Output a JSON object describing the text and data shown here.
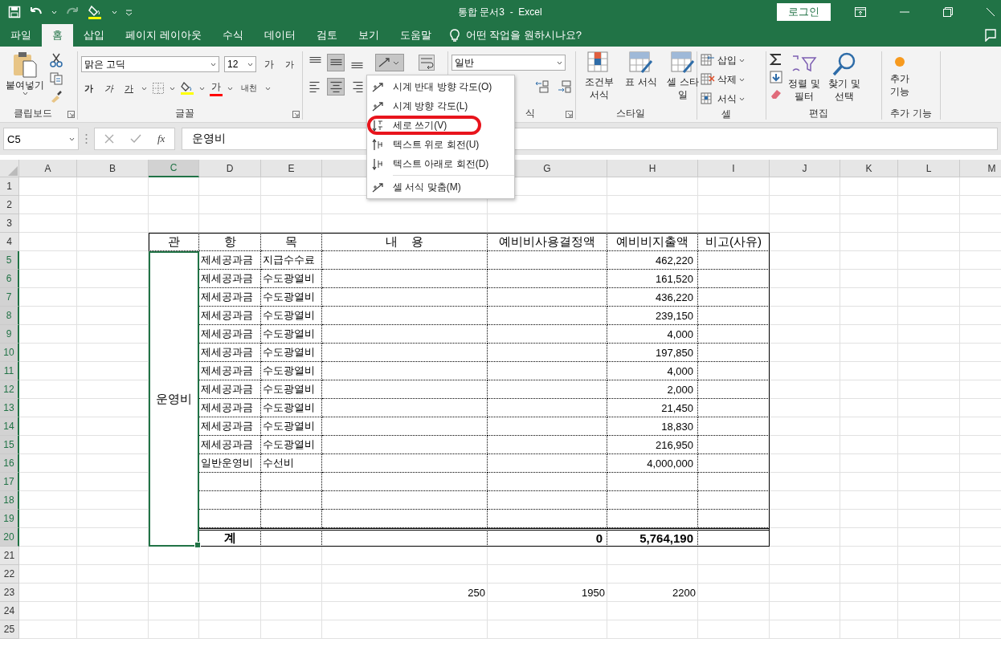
{
  "window": {
    "title": "통합 문서3  -  Excel",
    "login": "로그인"
  },
  "tabs": [
    {
      "label": "파일",
      "selected": false
    },
    {
      "label": "홈",
      "selected": true
    },
    {
      "label": "삽입",
      "selected": false
    },
    {
      "label": "페이지 레이아웃",
      "selected": false
    },
    {
      "label": "수식",
      "selected": false
    },
    {
      "label": "데이터",
      "selected": false
    },
    {
      "label": "검토",
      "selected": false
    },
    {
      "label": "보기",
      "selected": false
    },
    {
      "label": "도움말",
      "selected": false
    }
  ],
  "tell_me": "어떤 작업을 원하시나요?",
  "ribbon": {
    "clipboard": {
      "paste": "붙여넣기",
      "label": "클립보드"
    },
    "font": {
      "name": "맑은 고딕",
      "size": "12",
      "grow": "가",
      "shrink": "가",
      "bold": "가",
      "italic": "가",
      "underline": "가",
      "font_color": "가",
      "phonetic": "내천",
      "label": "글꼴"
    },
    "alignment": {
      "buttons": [
        {
          "kind": "top",
          "selected": false
        },
        {
          "kind": "middle",
          "selected": true
        },
        {
          "kind": "bottom",
          "selected": false
        },
        {
          "kind": "left",
          "selected": false
        },
        {
          "kind": "center",
          "selected": true
        },
        {
          "kind": "right",
          "selected": false
        }
      ],
      "orientation_expanded": true
    },
    "number": {
      "format": "일반",
      "label": "식"
    },
    "styles": {
      "items": [
        "조건부 서식",
        "표 서식",
        "셀 스타일"
      ],
      "label": "스타일"
    },
    "cells": {
      "items": [
        "삽입",
        "삭제",
        "서식"
      ],
      "label": "셀"
    },
    "editing": {
      "items": [
        "정렬 및 필터",
        "찾기 및 선택"
      ],
      "label": "편집"
    },
    "addins": {
      "item": "추가 기능",
      "label": "추가 기능"
    }
  },
  "orientation_menu": {
    "items": [
      {
        "label": "시계 반대 방향 각도(O)",
        "kind": "ccw",
        "highlighted": false
      },
      {
        "label": "시계 방향 각도(L)",
        "kind": "cw",
        "highlighted": false
      },
      {
        "label": "세로 쓰기(V)",
        "kind": "vertical",
        "highlighted": true
      },
      {
        "label": "텍스트 위로 회전(U)",
        "kind": "up",
        "highlighted": false
      },
      {
        "label": "텍스트 아래로 회전(D)",
        "kind": "down",
        "highlighted": false
      },
      {
        "label": "셀 서식 맞춤(M)",
        "kind": "format",
        "highlighted": false
      }
    ]
  },
  "formula_bar": {
    "name_box": "C5",
    "fx": "fx",
    "formula": "운영비"
  },
  "sheet": {
    "columns": [
      {
        "label": "A",
        "selected": false
      },
      {
        "label": "B",
        "selected": false
      },
      {
        "label": "C",
        "selected": true
      },
      {
        "label": "D",
        "selected": false
      },
      {
        "label": "E",
        "selected": false
      },
      {
        "selected": false
      },
      {
        "label": "G",
        "selected": false
      },
      {
        "label": "H",
        "selected": false
      },
      {
        "label": "I",
        "selected": false
      },
      {
        "label": "J",
        "selected": false
      },
      {
        "label": "K",
        "selected": false
      },
      {
        "label": "L",
        "selected": false
      },
      {
        "label": "M",
        "selected": false
      }
    ],
    "rows": [
      {
        "label": "1",
        "selected": false
      },
      {
        "label": "2",
        "selected": false
      },
      {
        "label": "3",
        "selected": false
      },
      {
        "label": "4",
        "selected": false
      },
      {
        "label": "5",
        "selected": true
      },
      {
        "label": "6",
        "selected": true
      },
      {
        "label": "7",
        "selected": true
      },
      {
        "label": "8",
        "selected": true
      },
      {
        "label": "9",
        "selected": true
      },
      {
        "label": "10",
        "selected": true
      },
      {
        "label": "11",
        "selected": true
      },
      {
        "label": "12",
        "selected": true
      },
      {
        "label": "13",
        "selected": true
      },
      {
        "label": "14",
        "selected": true
      },
      {
        "label": "15",
        "selected": true
      },
      {
        "label": "16",
        "selected": true
      },
      {
        "label": "17",
        "selected": true
      },
      {
        "label": "18",
        "selected": true
      },
      {
        "label": "19",
        "selected": true
      },
      {
        "label": "20",
        "selected": true
      },
      {
        "label": "21",
        "selected": false
      },
      {
        "label": "22",
        "selected": false
      },
      {
        "label": "23",
        "selected": false
      },
      {
        "label": "24",
        "selected": false
      },
      {
        "label": "25",
        "selected": false
      }
    ],
    "table": {
      "header": [
        "관",
        "항",
        "목",
        "내    용",
        "예비비사용결정액",
        "예비비지출액",
        "비고(사유)"
      ],
      "group": "운영비",
      "rows": [
        {
          "hang": "제세공과금",
          "mok": "지급수수료",
          "amount": "462,220"
        },
        {
          "hang": "제세공과금",
          "mok": "수도광열비",
          "amount": "161,520"
        },
        {
          "hang": "제세공과금",
          "mok": "수도광열비",
          "amount": "436,220"
        },
        {
          "hang": "제세공과금",
          "mok": "수도광열비",
          "amount": "239,150"
        },
        {
          "hang": "제세공과금",
          "mok": "수도광열비",
          "amount": "4,000"
        },
        {
          "hang": "제세공과금",
          "mok": "수도광열비",
          "amount": "197,850"
        },
        {
          "hang": "제세공과금",
          "mok": "수도광열비",
          "amount": "4,000"
        },
        {
          "hang": "제세공과금",
          "mok": "수도광열비",
          "amount": "2,000"
        },
        {
          "hang": "제세공과금",
          "mok": "수도광열비",
          "amount": "21,450"
        },
        {
          "hang": "제세공과금",
          "mok": "수도광열비",
          "amount": "18,830"
        },
        {
          "hang": "제세공과금",
          "mok": "수도광열비",
          "amount": "216,950"
        },
        {
          "hang": "일반운영비",
          "mok": "수선비",
          "amount": "4,000,000"
        },
        {},
        {},
        {}
      ],
      "total": {
        "label": "계",
        "decision": "0",
        "amount": "5,764,190"
      }
    },
    "extra_row": [
      "250",
      "1950",
      "2200"
    ]
  }
}
